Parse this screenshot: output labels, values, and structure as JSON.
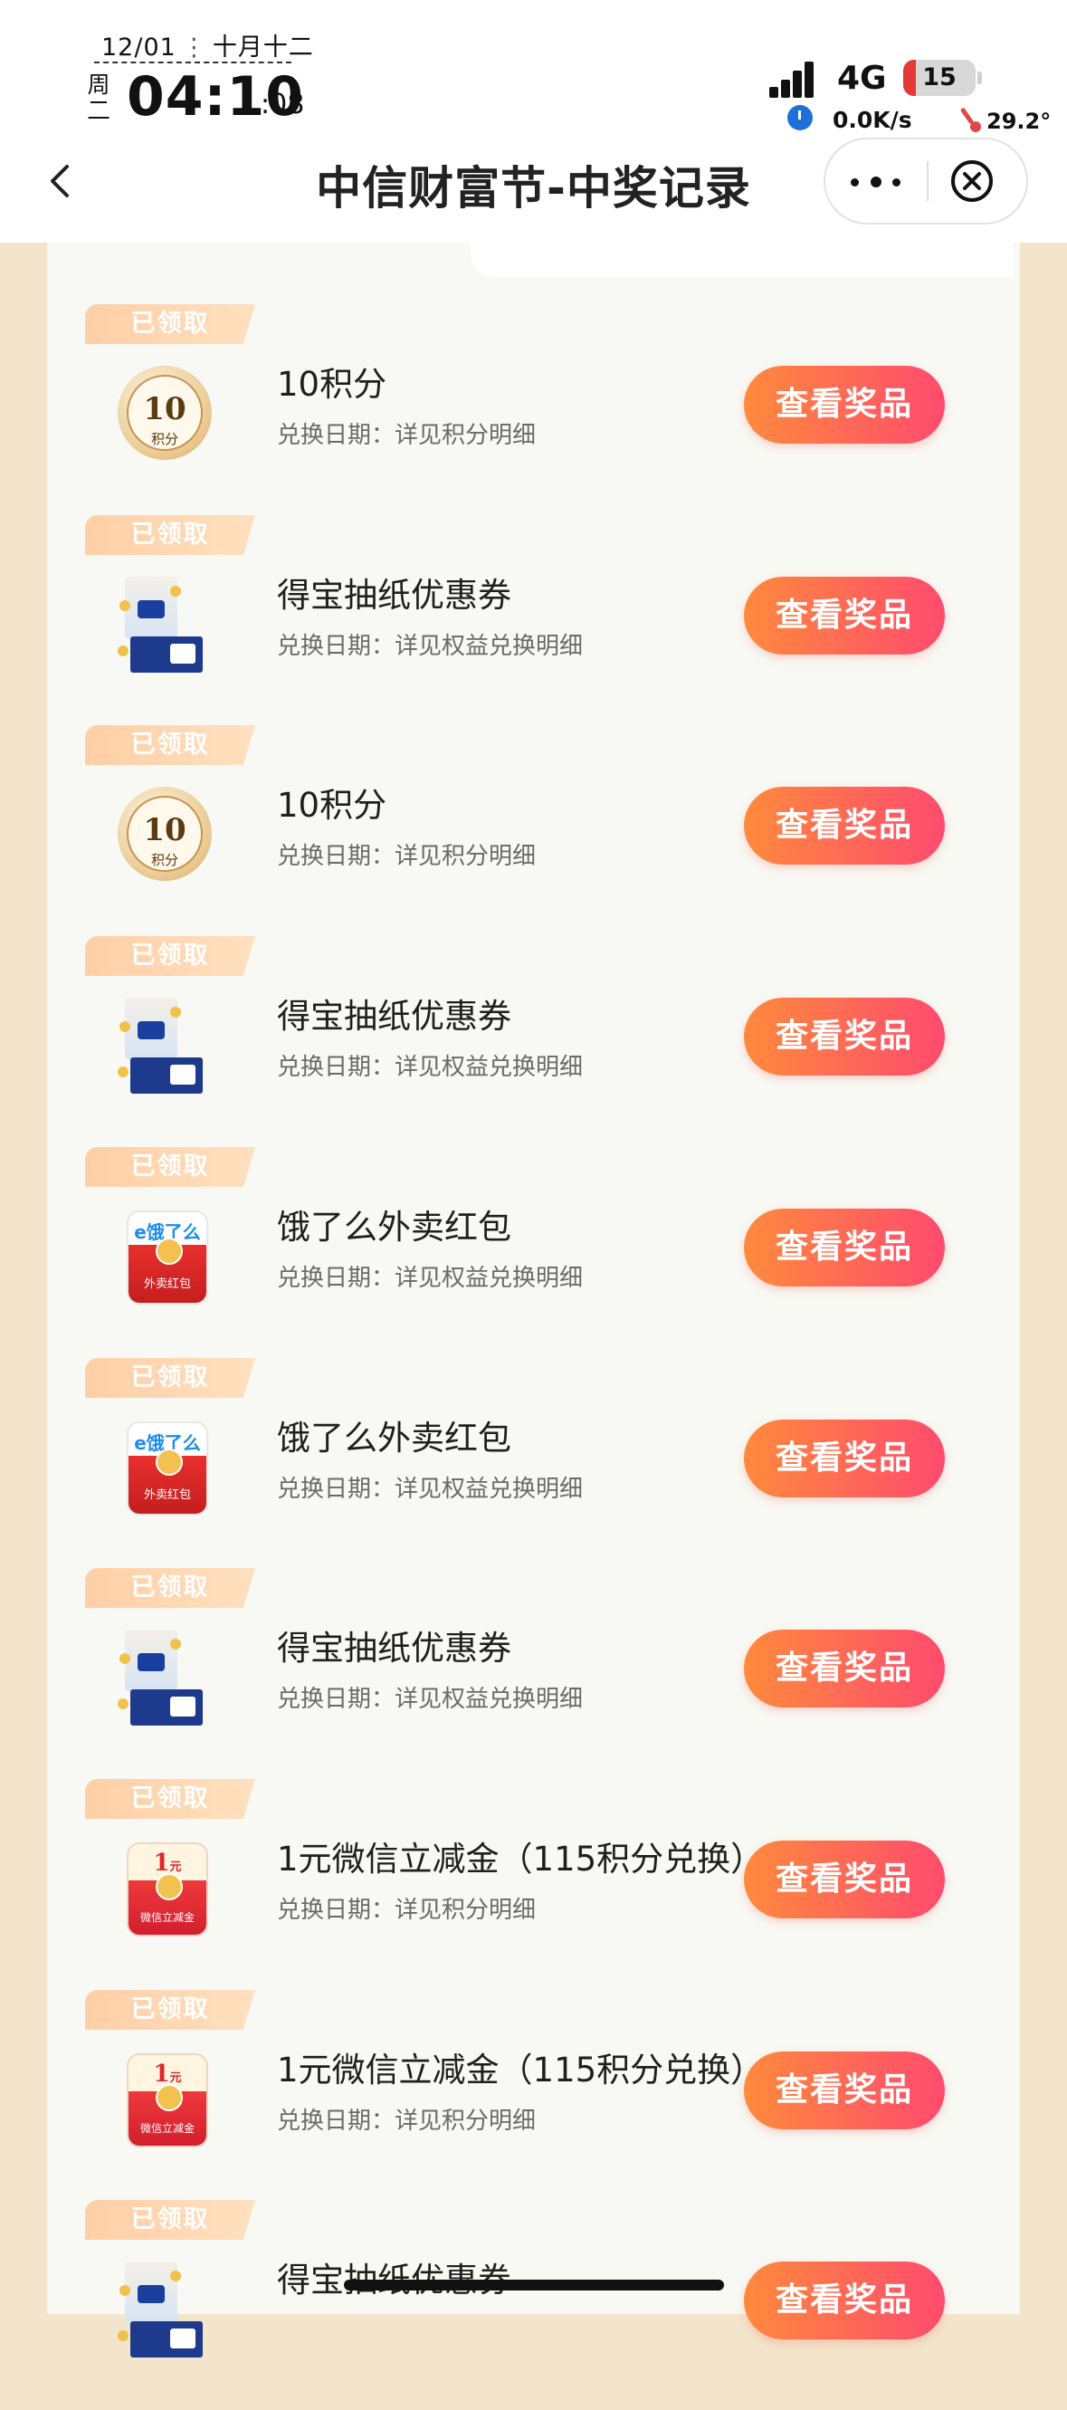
{
  "status_bar": {
    "date": "12/01",
    "lunar_date": "十月十二",
    "weekday_top": "周",
    "weekday_bottom": "一",
    "time": "04:10",
    "seconds": ":08",
    "network": "4G",
    "battery": "15",
    "net_speed": "0.0K/s",
    "temperature": "29.2°"
  },
  "header": {
    "title": "中信财富节-中奖记录",
    "back_icon": "chevron-left-icon",
    "more_icon": "more-dots-icon",
    "close_icon": "close-circle-icon"
  },
  "records": [
    {
      "status": "已领取",
      "thumb": "points-coin",
      "coin_value": "10",
      "coin_unit": "积分",
      "name": "10积分",
      "date": "兑换日期：详见积分明细",
      "button": "查看奖品"
    },
    {
      "status": "已领取",
      "thumb": "tissue",
      "name": "得宝抽纸优惠券",
      "date": "兑换日期：详见权益兑换明细",
      "button": "查看奖品"
    },
    {
      "status": "已领取",
      "thumb": "points-coin",
      "coin_value": "10",
      "coin_unit": "积分",
      "name": "10积分",
      "date": "兑换日期：详见积分明细",
      "button": "查看奖品"
    },
    {
      "status": "已领取",
      "thumb": "tissue",
      "name": "得宝抽纸优惠券",
      "date": "兑换日期：详见权益兑换明细",
      "button": "查看奖品"
    },
    {
      "status": "已领取",
      "thumb": "eleme-hongbao",
      "brand": "e饿了么",
      "badge": "外卖红包",
      "name": "饿了么外卖红包",
      "date": "兑换日期：详见权益兑换明细",
      "button": "查看奖品"
    },
    {
      "status": "已领取",
      "thumb": "eleme-hongbao",
      "brand": "e饿了么",
      "badge": "外卖红包",
      "name": "饿了么外卖红包",
      "date": "兑换日期：详见权益兑换明细",
      "button": "查看奖品"
    },
    {
      "status": "已领取",
      "thumb": "tissue",
      "name": "得宝抽纸优惠券",
      "date": "兑换日期：详见权益兑换明细",
      "button": "查看奖品"
    },
    {
      "status": "已领取",
      "thumb": "wechat-cash",
      "amount": "1",
      "amount_unit": "元",
      "badge": "微信立减金",
      "name": "1元微信立减金（115积分兑换）",
      "date": "兑换日期：详见积分明细",
      "button": "查看奖品"
    },
    {
      "status": "已领取",
      "thumb": "wechat-cash",
      "amount": "1",
      "amount_unit": "元",
      "badge": "微信立减金",
      "name": "1元微信立减金（115积分兑换）",
      "date": "兑换日期：详见积分明细",
      "button": "查看奖品"
    },
    {
      "status": "已领取",
      "thumb": "tissue",
      "name": "得宝抽纸优惠券",
      "date": "",
      "button": "查看奖品"
    }
  ],
  "colors": {
    "page_bg": "#f2e5cb",
    "panel_bg": "#f8f9f4",
    "button_gradient_start": "#ff8a3d",
    "button_gradient_end": "#ff4b6e",
    "tag_bg": "#ffd4ae"
  }
}
